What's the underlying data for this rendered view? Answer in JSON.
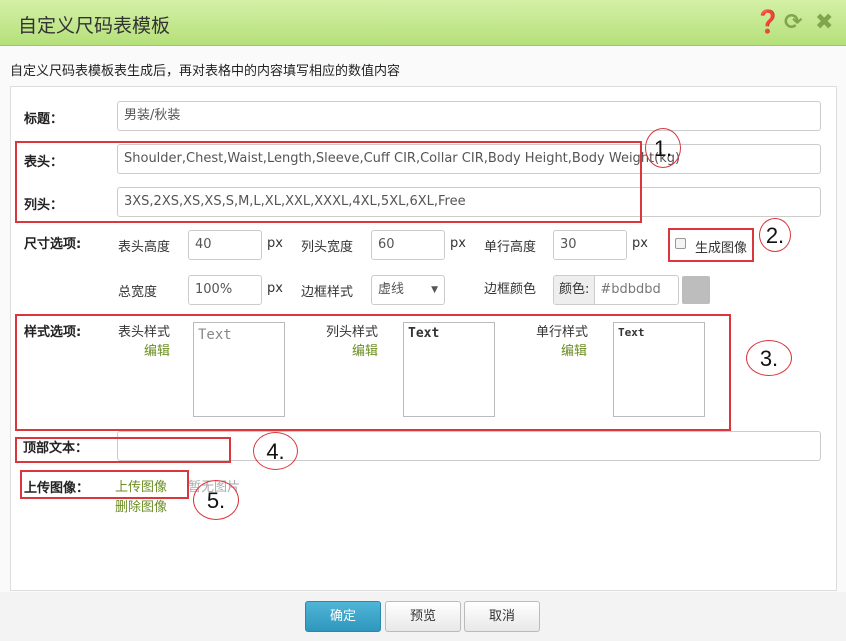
{
  "window": {
    "title": "自定义尺码表模板",
    "icons": [
      "help-icon",
      "refresh-icon",
      "close-icon"
    ]
  },
  "description": "自定义尺码表模板表生成后，再对表格中的内容填写相应的数值内容",
  "form": {
    "title_label": "标题：",
    "title_value": "男装/秋装",
    "header_label": "表头：",
    "header_value": "Shoulder,Chest,Waist,Length,Sleeve,Cuff CIR,Collar CIR,Body Height,Body Weight(kg)",
    "column_label": "列头：",
    "column_value": "3XS,2XS,XS,XS,S,M,L,XL,XXL,XXXL,4XL,5XL,6XL,Free",
    "size_label": "尺寸选项:",
    "header_height_label": "表头高度",
    "header_height": "40",
    "column_width_label": "列头宽度",
    "column_width": "60",
    "row_height_label": "单行高度",
    "row_height": "30",
    "unit": "px",
    "generate_image_label": "生成图像",
    "generate_image_checked": false,
    "total_width_label": "总宽度",
    "total_width": "100%",
    "border_style_label": "边框样式",
    "border_style": "虚线",
    "border_color_label": "边框颜色",
    "color_prefix": "颜色:",
    "border_color": "#bdbdbd",
    "style_label": "样式选项:",
    "header_style_label": "表头样式",
    "column_style_label": "列头样式",
    "row_style_label": "单行样式",
    "edit_label": "编辑",
    "preview_text": "Text",
    "top_text_label": "顶部文本：",
    "top_text_value": "",
    "upload_label": "上传图像：",
    "upload_link": "上传图像",
    "no_image": "暂无图片",
    "delete_link": "删除图像"
  },
  "annotations": [
    "1.",
    "2.",
    "3.",
    "4.",
    "5."
  ],
  "buttons": {
    "ok": "确定",
    "preview": "预览",
    "cancel": "取消"
  },
  "colors": {
    "accent": "#6b8e23",
    "primary": "#3aa3c9",
    "annotation": "#d9363e",
    "titlebar": "#c4e891"
  }
}
